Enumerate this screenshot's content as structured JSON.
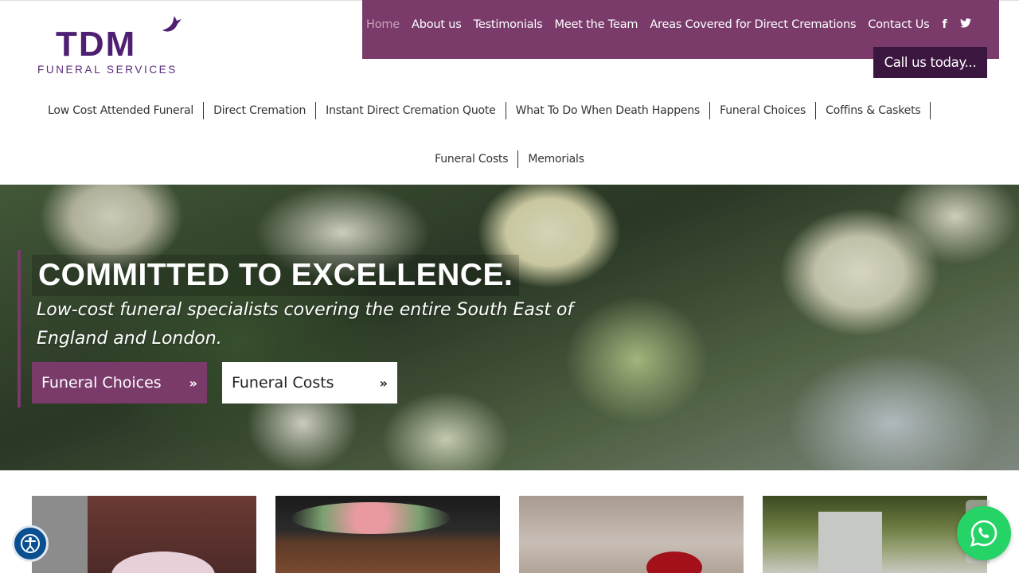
{
  "logo": {
    "mark": "TDM",
    "subtitle": "FUNERAL SERVICES"
  },
  "top_nav": {
    "items": [
      {
        "label": "Home",
        "active": true
      },
      {
        "label": "About us"
      },
      {
        "label": "Testimonials"
      },
      {
        "label": "Meet the Team"
      },
      {
        "label": "Areas Covered for Direct Cremations"
      },
      {
        "label": "Contact Us"
      }
    ],
    "social_icons": [
      "facebook-icon",
      "twitter-icon"
    ],
    "background": "#7a3b6b"
  },
  "call_button": {
    "label": "Call us today..."
  },
  "main_nav": {
    "row1": [
      "Low Cost Attended Funeral",
      "Direct Cremation",
      "Instant Direct Cremation Quote",
      "What To Do When Death Happens",
      "Funeral Choices",
      "Coffins & Caskets"
    ],
    "row2": [
      "Funeral Costs",
      "Memorials"
    ]
  },
  "hero": {
    "title": "COMMITTED TO EXCELLENCE.",
    "subtitle": "Low-cost funeral specialists covering the entire South East of England and London.",
    "buttons": [
      {
        "label": "Funeral Choices",
        "icon": "double-chevron-right-icon",
        "style": "primary"
      },
      {
        "label": "Funeral Costs",
        "icon": "double-chevron-right-icon",
        "style": "secondary"
      }
    ]
  },
  "cards": [
    {
      "image": "flower-wreath-photo"
    },
    {
      "image": "coffin-with-flowers-photo"
    },
    {
      "image": "red-rose-photo"
    },
    {
      "image": "woodland-path-photo"
    }
  ],
  "floating": {
    "accessibility_icon": "accessibility-icon",
    "whatsapp_icon": "whatsapp-icon"
  },
  "colors": {
    "brand_purple": "#7a3b6b",
    "logo_purple": "#4e1f73",
    "call_bg": "#3b1740",
    "whatsapp": "#25d366",
    "accessibility": "#0a4f8f"
  }
}
